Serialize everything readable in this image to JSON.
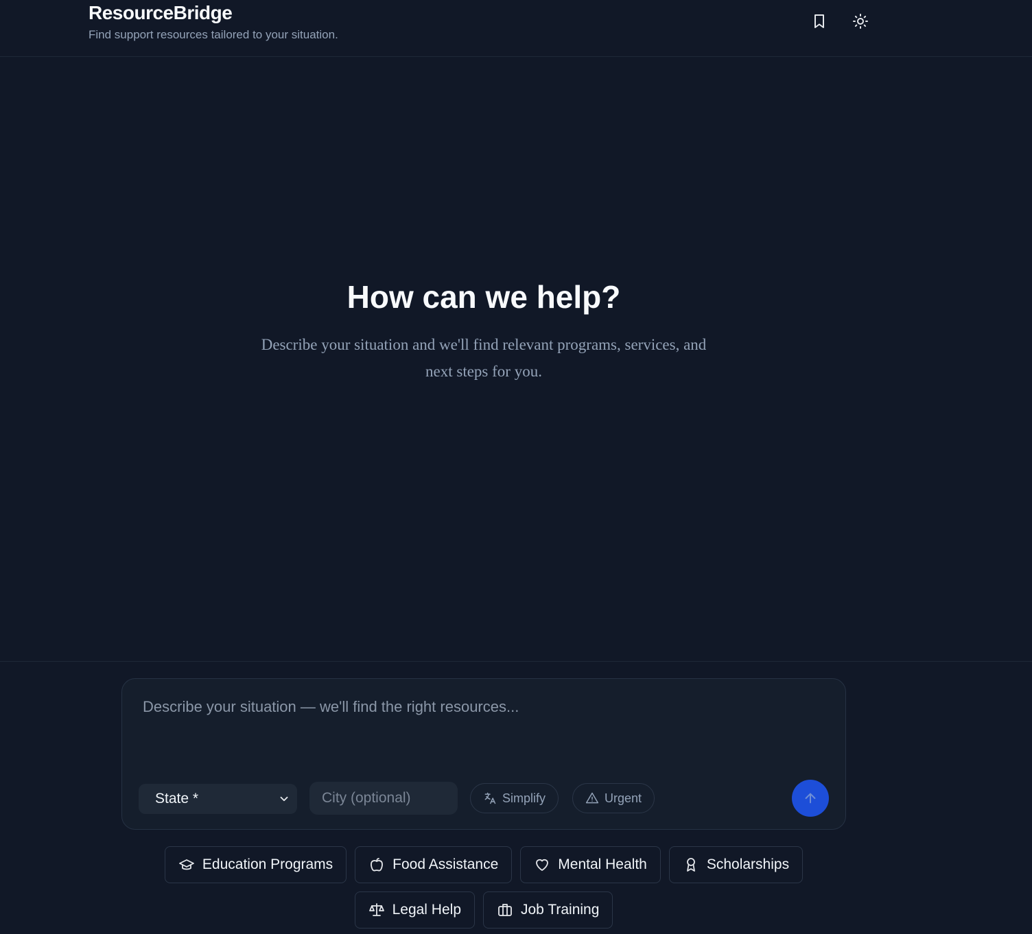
{
  "header": {
    "title": "ResourceBridge",
    "subtitle": "Find support resources tailored to your situation.",
    "icons": [
      "bookmark-icon",
      "sun-icon"
    ]
  },
  "hero": {
    "title": "How can we help?",
    "subtitle": "Describe your situation and we'll find relevant programs, services, and next steps for you."
  },
  "composer": {
    "placeholder": "Describe your situation — we'll find the right resources...",
    "state_label": "State *",
    "city_placeholder": "City (optional)",
    "simplify_label": "Simplify",
    "urgent_label": "Urgent"
  },
  "categories": [
    {
      "label": "Education Programs",
      "icon": "graduation-cap-icon"
    },
    {
      "label": "Food Assistance",
      "icon": "apple-icon"
    },
    {
      "label": "Mental Health",
      "icon": "heart-icon"
    },
    {
      "label": "Scholarships",
      "icon": "award-icon"
    },
    {
      "label": "Legal Help",
      "icon": "scale-icon"
    },
    {
      "label": "Job Training",
      "icon": "briefcase-icon"
    }
  ],
  "colors": {
    "background": "#111827",
    "surface": "#151e2c",
    "accent": "#1d4ed8",
    "muted_text": "#94a3b8"
  }
}
